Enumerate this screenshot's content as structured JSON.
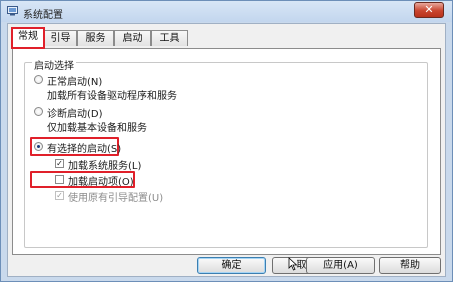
{
  "window": {
    "title": "系统配置",
    "close_label": "✕"
  },
  "tabs": [
    {
      "label": "常规",
      "active": true
    },
    {
      "label": "引导"
    },
    {
      "label": "服务"
    },
    {
      "label": "启动"
    },
    {
      "label": "工具"
    }
  ],
  "startup_selection": {
    "group_title": "启动选择",
    "normal": {
      "label": "正常启动(N)",
      "description": "加载所有设备驱动程序和服务"
    },
    "diagnostic": {
      "label": "诊断启动(D)",
      "description": "仅加载基本设备和服务"
    },
    "selective": {
      "label": "有选择的启动(S)",
      "checked": true,
      "options": [
        {
          "label": "加载系统服务(L)",
          "checked": true,
          "enabled": true
        },
        {
          "label": "加载启动项(O)",
          "checked": false,
          "enabled": true
        },
        {
          "label": "使用原有引导配置(U)",
          "checked": true,
          "enabled": false
        }
      ]
    }
  },
  "buttons": {
    "ok": "确定",
    "cancel": "取消",
    "apply": "应用(A)",
    "help": "帮助"
  },
  "colors": {
    "highlight": "#e0202a",
    "accent": "#3c7fb1"
  }
}
